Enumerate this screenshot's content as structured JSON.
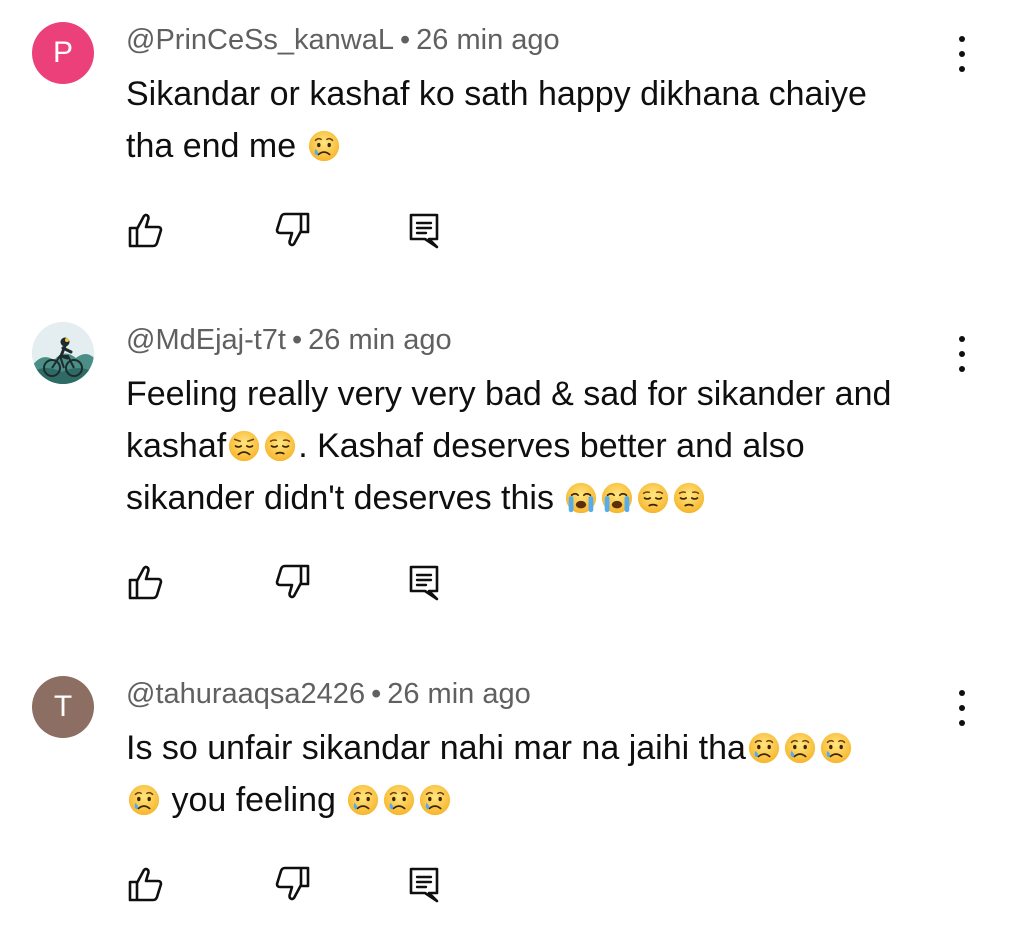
{
  "colors": {
    "avatar_p": "#ec407a",
    "avatar_t": "#8d6e63",
    "meta_text": "#606060",
    "body_text": "#0f0f0f"
  },
  "comments": [
    {
      "avatar_letter": "P",
      "author": "@PrinCeSs_kanwaL",
      "separator": "•",
      "time": "26 min ago",
      "text_lines": [
        "Sikandar or kashaf ko sath happy dikhana chaiye",
        "tha end me"
      ],
      "emojis": [
        "crying-face"
      ]
    },
    {
      "avatar_letter": "",
      "author": "@MdEjaj-t7t",
      "separator": "•",
      "time": "26 min ago",
      "text_lines": [
        "Feeling really very very bad & sad for sikander and",
        "kashaf",
        ". Kashaf deserves better and also",
        "sikander didn't deserves this"
      ],
      "emojis": [
        "disappointed-face",
        "pensive-face",
        "loudly-crying-face",
        "loudly-crying-face",
        "pensive-face",
        "pensive-face"
      ]
    },
    {
      "avatar_letter": "T",
      "author": "@tahuraaqsa2426",
      "separator": "•",
      "time": "26 min ago",
      "text_lines": [
        "Is so unfair sikandar nahi mar na jaihi tha",
        "you feeling"
      ],
      "emojis": [
        "crying-face",
        "crying-face",
        "crying-face",
        "crying-face",
        "crying-face",
        "crying-face",
        "crying-face"
      ]
    }
  ],
  "icons": {
    "like": "thumbs-up-icon",
    "dislike": "thumbs-down-icon",
    "reply": "reply-icon",
    "more": "more-vert-icon"
  }
}
